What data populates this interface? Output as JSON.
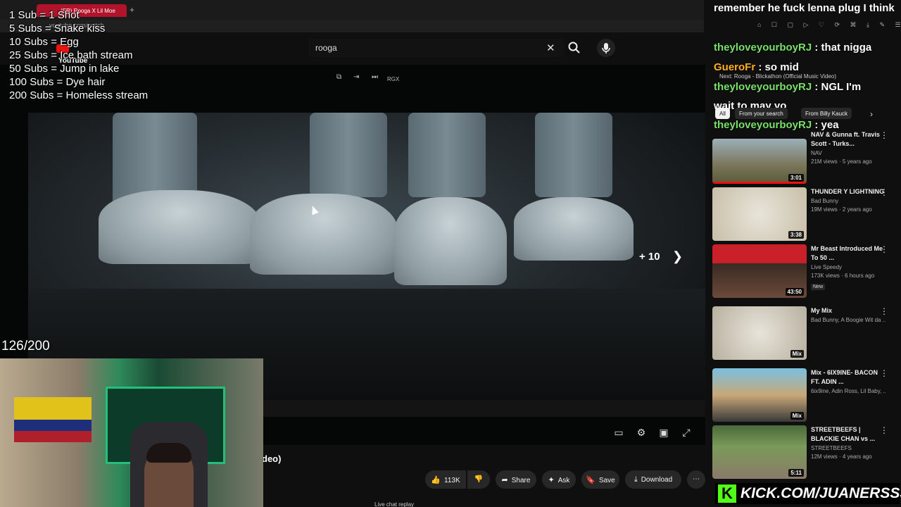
{
  "browser": {
    "tab_title": "(SR) Rooga X Lil Moe",
    "url": "youtube.com/watch"
  },
  "youtube": {
    "logo": "YouTube",
    "search_value": "rooga",
    "next_count": "+ 10",
    "title_fragment": "deo)"
  },
  "stream_overlay": {
    "goals": [
      "1 Sub = 1 Shot",
      "5 Subs = Snake kiss",
      "10 Subs = Egg",
      "25 Subs = Ice bath stream",
      "50 Subs = Jump in lake",
      "100 Subs = Dye hair",
      "200 Subs = Homeless stream"
    ],
    "sub_count": "126/200"
  },
  "video_controls": {
    "top": [
      "RGX"
    ]
  },
  "actions": {
    "likes": "113K",
    "share": "Share",
    "ask": "Ask",
    "save": "Save",
    "download": "Download"
  },
  "live_chat_replay": "Live chat replay",
  "chat": {
    "topline": "remember he fuck lenna plug I think",
    "messages": [
      {
        "user": "theyloveyourboyRJ",
        "text": ": that nigga",
        "color": "#79e06a"
      },
      {
        "user": "GueroFr",
        "text": ": so mid",
        "color": "#ffb020"
      },
      {
        "user": "theyloveyourboyRJ",
        "text": ": NGL I'm",
        "color": "#79e06a"
      },
      {
        "user": "",
        "text": "wait to may yo",
        "color": "#ffffff"
      },
      {
        "user": "theyloveyourboyRJ",
        "text": ": yea",
        "color": "#79e06a"
      }
    ]
  },
  "next_up": "Next: Rooga - Blickathon (Official Music Video)",
  "filters": [
    "All",
    "From your search",
    "From Billy Kauck"
  ],
  "recommendations": [
    {
      "title": "NAV & Gunna ft. Travis Scott - Turks...",
      "channel": "NAV",
      "meta": "21M views · 5 years ago",
      "duration": "3:01",
      "badge": ""
    },
    {
      "title": "THUNDER Y LIGHTNING",
      "channel": "Bad Bunny",
      "meta": "19M views · 2 years ago",
      "duration": "3:38",
      "badge": ""
    },
    {
      "title": "Mr Beast Introduced Me To 50 ...",
      "channel": "Live Speedy",
      "meta": "173K views · 6 hours ago",
      "duration": "43:50",
      "badge": "New"
    },
    {
      "title": "My Mix",
      "channel": "Bad Bunny, A Boogie Wit da ...",
      "meta": "",
      "duration": "Mix",
      "badge": ""
    },
    {
      "title": "Mix - 6IX9INE- BACON FT. ADIN ...",
      "channel": "6ix9ine, Adin Ross, Lil Baby, ...",
      "meta": "",
      "duration": "Mix",
      "badge": ""
    },
    {
      "title": "STREETBEEFS | BLACKIE CHAN vs ...",
      "channel": "STREETBEEFS",
      "meta": "12M views · 4 years ago",
      "duration": "5:11",
      "badge": ""
    }
  ],
  "kick": {
    "logo": "K",
    "handle": "KICK.COM/JUANERSSS"
  }
}
